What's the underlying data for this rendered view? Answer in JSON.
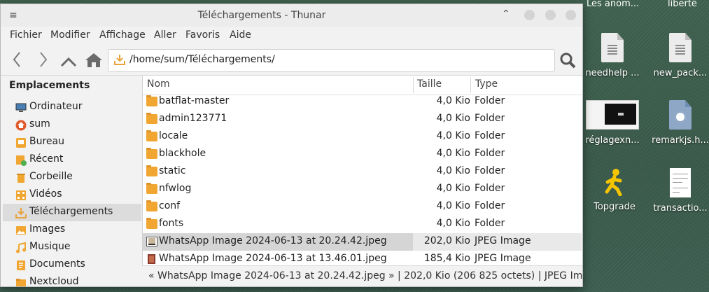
{
  "desktop": {
    "top_labels": [
      "Les anom...",
      "liberté"
    ],
    "icons": [
      {
        "label": "needhelp ...",
        "icon": "text-file-icon"
      },
      {
        "label": "new_pack...",
        "icon": "text-file-icon"
      },
      {
        "label": "réglagexn...",
        "icon": "screenshot-thumbnail-icon"
      },
      {
        "label": "remarkjs.h...",
        "icon": "html-file-icon"
      },
      {
        "label": "Topgrade",
        "icon": "running-person-icon"
      },
      {
        "label": "transactio...",
        "icon": "document-thumbnail-icon"
      }
    ]
  },
  "window": {
    "title": "Téléchargements - Thunar",
    "menu": [
      "Fichier",
      "Modifier",
      "Affichage",
      "Aller",
      "Favoris",
      "Aide"
    ],
    "path": "/home/sum/Téléchargements/"
  },
  "sidebar": {
    "heading": "Emplacements",
    "items": [
      {
        "label": "Ordinateur",
        "icon": "computer-icon"
      },
      {
        "label": "sum",
        "icon": "home-icon"
      },
      {
        "label": "Bureau",
        "icon": "desktop-icon"
      },
      {
        "label": "Récent",
        "icon": "recent-icon"
      },
      {
        "label": "Corbeille",
        "icon": "trash-icon"
      },
      {
        "label": "Vidéos",
        "icon": "videos-icon"
      },
      {
        "label": "Téléchargements",
        "icon": "downloads-icon",
        "selected": true
      },
      {
        "label": "Images",
        "icon": "images-icon"
      },
      {
        "label": "Musique",
        "icon": "music-icon"
      },
      {
        "label": "Documents",
        "icon": "documents-icon"
      },
      {
        "label": "Nextcloud",
        "icon": "folder-icon"
      }
    ]
  },
  "filelist": {
    "columns": {
      "name": "Nom",
      "size": "Taille",
      "type": "Type"
    },
    "rows": [
      {
        "name": "batflat-master",
        "size": "4,0 Kio",
        "type": "Folder"
      },
      {
        "name": "admin123771",
        "size": "4,0 Kio",
        "type": "Folder"
      },
      {
        "name": "locale",
        "size": "4,0 Kio",
        "type": "Folder"
      },
      {
        "name": "blackhole",
        "size": "4,0 Kio",
        "type": "Folder"
      },
      {
        "name": "static",
        "size": "4,0 Kio",
        "type": "Folder"
      },
      {
        "name": "nfwlog",
        "size": "4,0 Kio",
        "type": "Folder"
      },
      {
        "name": "conf",
        "size": "4,0 Kio",
        "type": "Folder"
      },
      {
        "name": "fonts",
        "size": "4,0 Kio",
        "type": "Folder"
      },
      {
        "name": "WhatsApp Image 2024-06-13 at 20.24.42.jpeg",
        "size": "202,0 Kio",
        "type": "JPEG Image",
        "selected": true
      },
      {
        "name": "WhatsApp Image 2024-06-13 at 13.46.01.jpeg",
        "size": "185,4 Kio",
        "type": "JPEG Image"
      }
    ]
  },
  "statusbar": {
    "text": "« WhatsApp Image 2024-06-13 at 20.24.42.jpeg »  |  202,0 Kio (206 825 octets)  |  JPEG Im..."
  },
  "colors": {
    "folder": "#f0a630",
    "accent_download": "#e8a33d",
    "selection": "#d5d5d5"
  }
}
